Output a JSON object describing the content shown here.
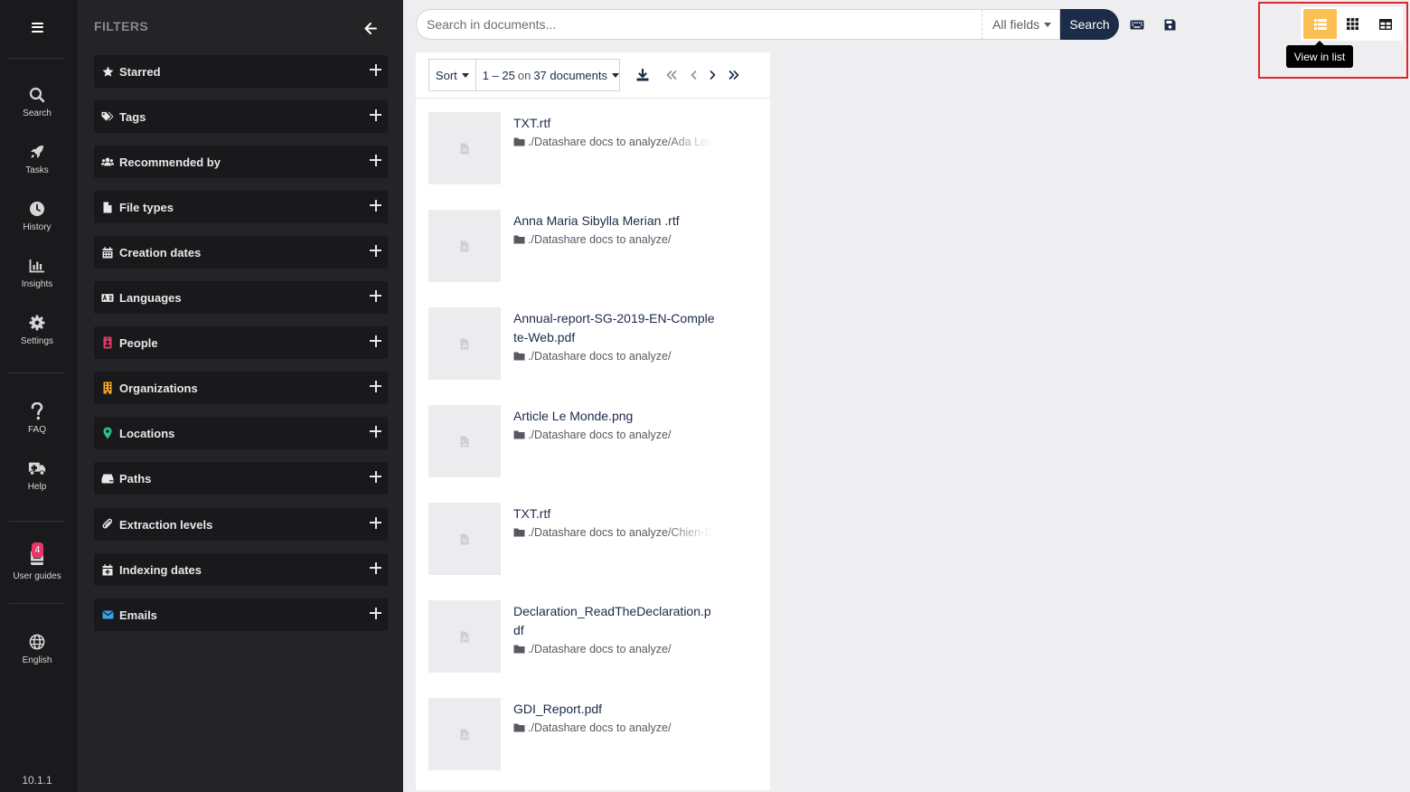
{
  "menu": {
    "items": [
      {
        "label": "Search",
        "icon": "search-icon"
      },
      {
        "label": "Tasks",
        "icon": "rocket-icon"
      },
      {
        "label": "History",
        "icon": "clock-icon"
      },
      {
        "label": "Insights",
        "icon": "chart-icon"
      },
      {
        "label": "Settings",
        "icon": "gear-icon"
      },
      {
        "label": "FAQ",
        "icon": "question-icon"
      },
      {
        "label": "Help",
        "icon": "ambulance-icon"
      },
      {
        "label": "User guides",
        "icon": "book-icon",
        "badge": "4"
      },
      {
        "label": "English",
        "icon": "globe-icon"
      }
    ],
    "version": "10.1.1"
  },
  "filters": {
    "title": "FILTERS",
    "items": [
      {
        "label": "Starred",
        "icon": "star-icon",
        "color": "#e8e8ea"
      },
      {
        "label": "Tags",
        "icon": "tags-icon",
        "color": "#e8e8ea"
      },
      {
        "label": "Recommended by",
        "icon": "users-icon",
        "color": "#e8e8ea"
      },
      {
        "label": "File types",
        "icon": "file-icon",
        "color": "#e8e8ea"
      },
      {
        "label": "Creation dates",
        "icon": "calendar-icon",
        "color": "#e8e8ea"
      },
      {
        "label": "Languages",
        "icon": "language-icon",
        "color": "#e8e8ea"
      },
      {
        "label": "People",
        "icon": "id-badge-icon",
        "color": "#e5396a"
      },
      {
        "label": "Organizations",
        "icon": "building-icon",
        "color": "#f5a623"
      },
      {
        "label": "Locations",
        "icon": "map-marker-icon",
        "color": "#2fbf8f"
      },
      {
        "label": "Paths",
        "icon": "hdd-icon",
        "color": "#e8e8ea"
      },
      {
        "label": "Extraction levels",
        "icon": "paperclip-icon",
        "color": "#e8e8ea"
      },
      {
        "label": "Indexing dates",
        "icon": "calendar-plus-icon",
        "color": "#e8e8ea"
      },
      {
        "label": "Emails",
        "icon": "envelope-icon",
        "color": "#3aa0e8"
      }
    ]
  },
  "search": {
    "placeholder": "Search in documents...",
    "field": "All fields",
    "button": "Search"
  },
  "view": {
    "tooltip": "View in list",
    "active": "list"
  },
  "results": {
    "sort": "Sort",
    "range": "1 – 25",
    "on": "on",
    "total": "37 documents",
    "documents": [
      {
        "title": "TXT.rtf",
        "path": "./Datashare docs to analyze/Ada Lov",
        "icon": "file-text-icon",
        "fade": true
      },
      {
        "title": "Anna Maria Sibylla Merian .rtf",
        "path": "./Datashare docs to analyze/",
        "icon": "file-text-icon",
        "fade": false
      },
      {
        "title": "Annual-report-SG-2019-EN-Complete-Web.pdf",
        "path": "./Datashare docs to analyze/",
        "icon": "file-pdf-icon",
        "fade": false
      },
      {
        "title": "Article Le Monde.png",
        "path": "./Datashare docs to analyze/",
        "icon": "file-image-icon",
        "fade": false
      },
      {
        "title": "TXT.rtf",
        "path": "./Datashare docs to analyze/Chien-S",
        "icon": "file-text-icon",
        "fade": true
      },
      {
        "title": "Declaration_ReadTheDeclaration.pdf",
        "path": "./Datashare docs to analyze/",
        "icon": "file-pdf-icon",
        "fade": false
      },
      {
        "title": "GDI_Report.pdf",
        "path": "./Datashare docs to analyze/",
        "icon": "file-pdf-icon",
        "fade": false
      }
    ]
  },
  "colors": {
    "accent": "#1b2b48",
    "view_active": "#fbbf56",
    "highlight": "#e0262a"
  }
}
